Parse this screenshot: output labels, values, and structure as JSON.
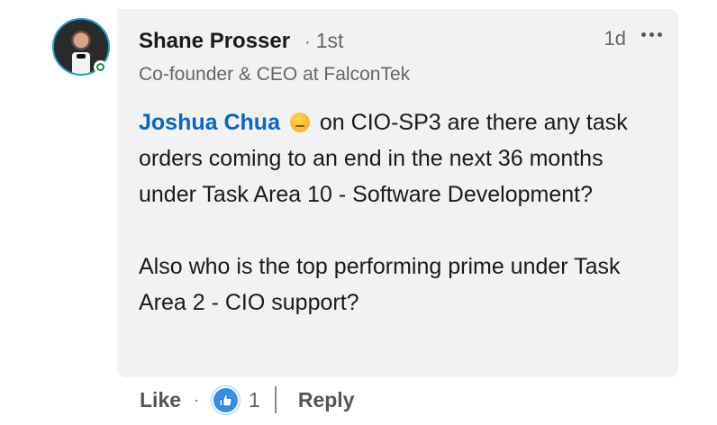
{
  "comment": {
    "author": {
      "name": "Shane Prosser",
      "degree": "1st",
      "headline": "Co-founder & CEO at FalconTek"
    },
    "timestamp": "1d",
    "mention": "Joshua Chua",
    "text_after_mention": "on CIO-SP3 are there any task orders coming to an end in the next 36 months under Task Area 10 - Software Development?",
    "text_second": "Also who is the top performing prime under Task Area 2 - CIO support?"
  },
  "actions": {
    "like_label": "Like",
    "separator": "·",
    "like_count": "1",
    "reply_label": "Reply"
  },
  "icons": {
    "avatar": "profile-photo",
    "online_status": "online-status-icon",
    "more": "ellipsis-icon",
    "emoji": "thinking-face-emoji",
    "reaction": "like-reaction-icon"
  },
  "colors": {
    "mention": "#0a66c2",
    "bubble": "#f2f2f2",
    "reaction": "#378fe9",
    "online": "#178a3e"
  }
}
